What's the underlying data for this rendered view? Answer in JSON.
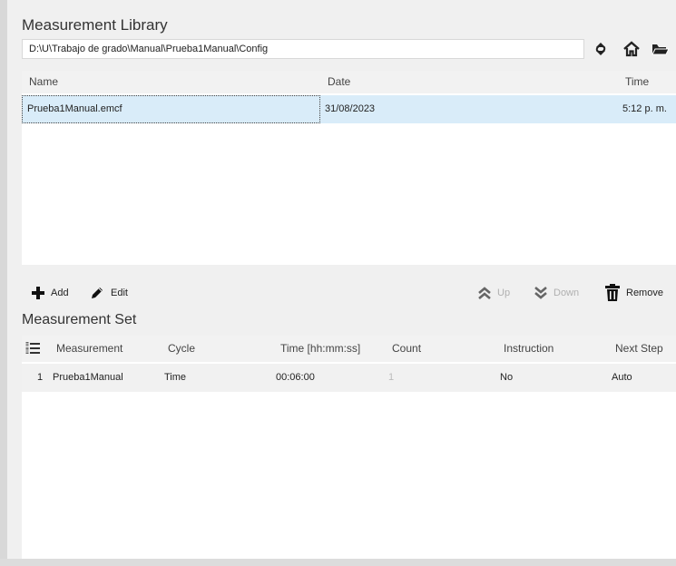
{
  "library": {
    "title": "Measurement Library",
    "path": "D:\\U\\Trabajo de grado\\Manual\\Prueba1Manual\\Config",
    "columns": {
      "name": "Name",
      "date": "Date",
      "time": "Time"
    },
    "rows": [
      {
        "name": "Prueba1Manual.emcf",
        "date": "31/08/2023",
        "time": "5:12 p. m."
      }
    ]
  },
  "toolbar": {
    "add": "Add",
    "edit": "Edit",
    "up": "Up",
    "down": "Down",
    "remove": "Remove"
  },
  "set": {
    "title": "Measurement Set",
    "columns": {
      "measurement": "Measurement",
      "cycle": "Cycle",
      "time": "Time [hh:mm:ss]",
      "count": "Count",
      "instruction": "Instruction",
      "next_step": "Next Step"
    },
    "rows": [
      {
        "index": "1",
        "measurement": "Prueba1Manual",
        "cycle": "Time",
        "time": "00:06:00",
        "count": "1",
        "instruction": "No",
        "next_step": "Auto"
      }
    ]
  },
  "icons": {
    "refresh": "refresh-icon",
    "home": "home-icon",
    "folder": "folder-open-icon"
  }
}
